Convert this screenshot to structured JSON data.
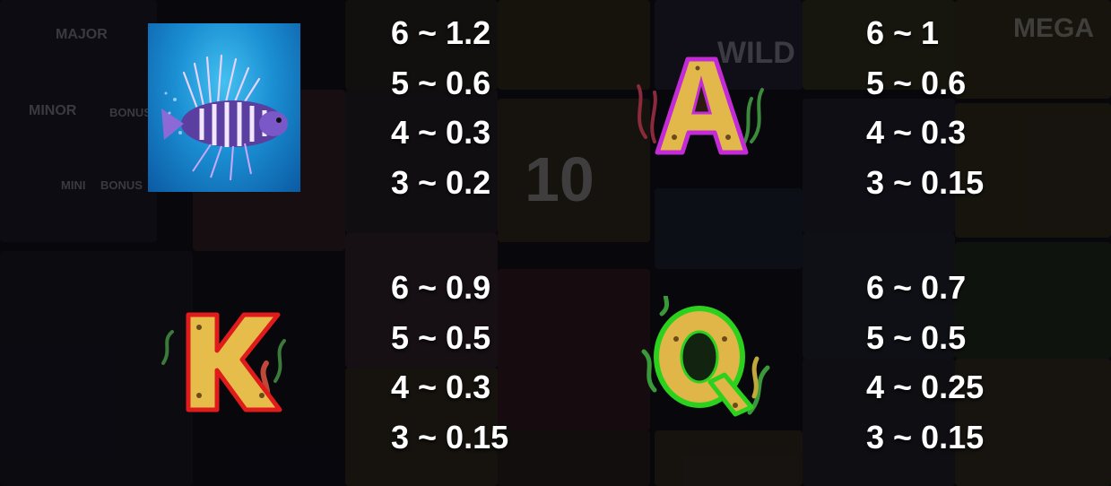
{
  "background": {
    "ghost_labels": [
      "MAJOR",
      "MINOR",
      "BONUS",
      "MINI",
      "BONUS",
      "WILD",
      "MEGA",
      "10"
    ]
  },
  "paytable": [
    {
      "symbol_name": "lionfish",
      "payouts": [
        "6 ~ 1.2",
        "5 ~ 0.6",
        "4 ~ 0.3",
        "3 ~ 0.2"
      ]
    },
    {
      "symbol_name": "A",
      "letter": "A",
      "frame_color": "#c02bd8",
      "payouts": [
        "6 ~ 1",
        "5 ~ 0.6",
        "4 ~ 0.3",
        "3 ~ 0.15"
      ]
    },
    {
      "symbol_name": "K",
      "letter": "K",
      "frame_color": "#e11a1a",
      "payouts": [
        "6 ~ 0.9",
        "5 ~ 0.5",
        "4 ~ 0.3",
        "3 ~ 0.15"
      ]
    },
    {
      "symbol_name": "Q",
      "letter": "Q",
      "frame_color": "#2fd11f",
      "payouts": [
        "6 ~ 0.7",
        "5 ~ 0.5",
        "4 ~ 0.25",
        "3 ~ 0.15"
      ]
    }
  ]
}
